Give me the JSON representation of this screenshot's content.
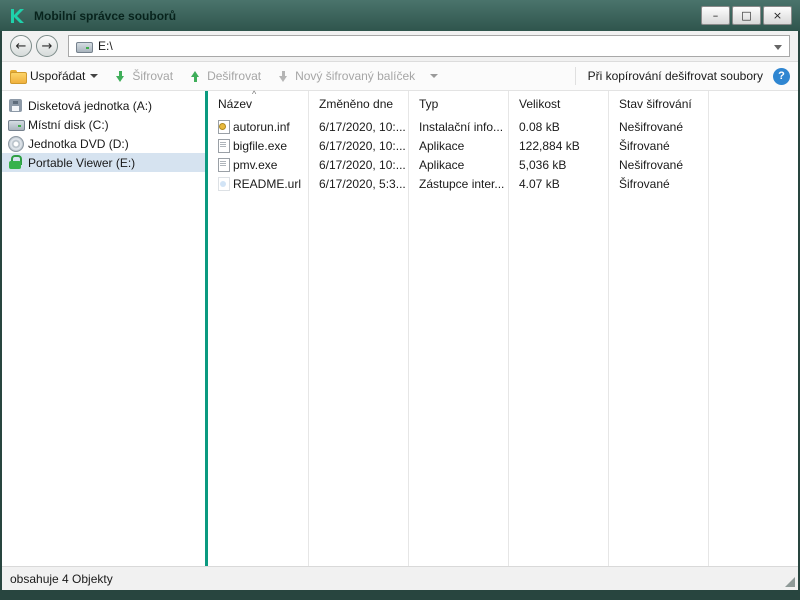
{
  "window": {
    "title": "Mobilní správce souborů",
    "controls": {
      "minimize": "–",
      "maximize": "□",
      "close": "×"
    }
  },
  "navigation": {
    "back_glyph": "←",
    "forward_glyph": "→",
    "address": "E:\\"
  },
  "toolbar": {
    "organize_label": "Uspořádat",
    "encrypt_label": "Šifrovat",
    "decrypt_label": "Dešifrovat",
    "new_package_label": "Nový šifrovaný balíček",
    "decrypt_on_copy_label": "Při kopírování dešifrovat soubory",
    "help_glyph": "?"
  },
  "sidebar": {
    "items": [
      {
        "label": "Disketová jednotka (A:)",
        "icon": "floppy-icon",
        "selected": false
      },
      {
        "label": "Místní disk (C:)",
        "icon": "disk-icon",
        "selected": false
      },
      {
        "label": "Jednotka DVD (D:)",
        "icon": "dvd-icon",
        "selected": false
      },
      {
        "label": "Portable Viewer (E:)",
        "icon": "lock-icon",
        "selected": true
      }
    ]
  },
  "file_list": {
    "sort_indicator": "^",
    "columns": [
      "Název",
      "Změněno dne",
      "Typ",
      "Velikost",
      "Stav šifrování"
    ],
    "rows": [
      {
        "icon": "inf-file-icon",
        "name": "autorun.inf",
        "modified": "6/17/2020, 10:...",
        "type": "Instalační info...",
        "size": "0.08 kB",
        "status": "Nešifrované"
      },
      {
        "icon": "file-icon",
        "name": "bigfile.exe",
        "modified": "6/17/2020, 10:...",
        "type": "Aplikace",
        "size": "122,884 kB",
        "status": "Šifrované"
      },
      {
        "icon": "file-icon",
        "name": "pmv.exe",
        "modified": "6/17/2020, 10:...",
        "type": "Aplikace",
        "size": "5,036 kB",
        "status": "Nešifrované"
      },
      {
        "icon": "url-file-icon",
        "name": "README.url",
        "modified": "6/17/2020, 5:3...",
        "type": "Zástupce inter...",
        "size": "4.07 kB",
        "status": "Šifrované"
      }
    ]
  },
  "status_bar": {
    "text": "obsahuje 4 Objekty"
  },
  "colors": {
    "accent_teal": "#0b9a80",
    "chrome": "#28453f",
    "selection": "#d6e3f0",
    "help_blue": "#2f86d1",
    "folder_yellow": "#f0b13e",
    "lock_green": "#37b24d"
  }
}
